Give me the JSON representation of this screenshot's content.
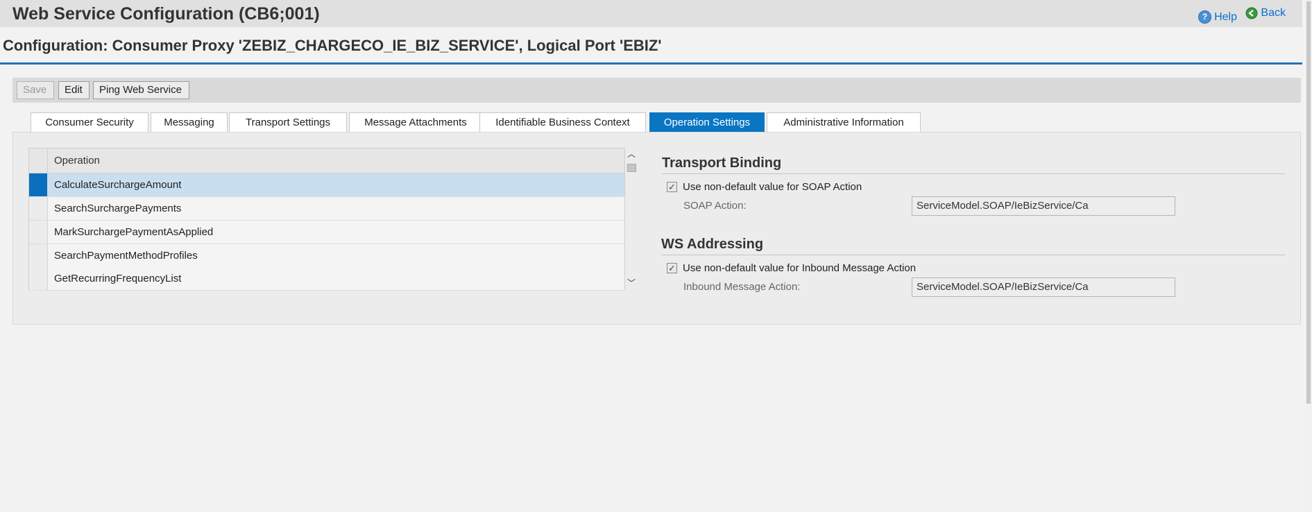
{
  "window": {
    "title": "Web Service Configuration (CB6;001)",
    "help_label": "Help",
    "back_label": "Back"
  },
  "subtitle": "Configuration: Consumer Proxy 'ZEBIZ_CHARGECO_IE_BIZ_SERVICE', Logical Port 'EBIZ'",
  "toolbar": {
    "save_label": "Save",
    "edit_label": "Edit",
    "ping_label": "Ping Web Service"
  },
  "tabs": [
    {
      "label": "Consumer Security"
    },
    {
      "label": "Messaging"
    },
    {
      "label": "Transport Settings"
    },
    {
      "label": "Message Attachments"
    },
    {
      "label": "Identifiable Business Context"
    },
    {
      "label": "Operation Settings",
      "active": true
    },
    {
      "label": "Administrative Information"
    }
  ],
  "operations_table": {
    "header": "Operation",
    "rows": [
      "CalculateSurchargeAmount",
      "SearchSurchargePayments",
      "MarkSurchargePaymentAsApplied",
      "SearchPaymentMethodProfiles",
      "GetRecurringFrequencyList"
    ],
    "selected_index": 0
  },
  "transport_binding": {
    "title": "Transport Binding",
    "checkbox_label": "Use non-default value for SOAP Action",
    "checked": true,
    "field_label": "SOAP Action:",
    "field_value": "ServiceModel.SOAP/IeBizService/Ca"
  },
  "ws_addressing": {
    "title": "WS Addressing",
    "checkbox_label": "Use non-default value for Inbound Message Action",
    "checked": true,
    "field_label": "Inbound Message Action:",
    "field_value": "ServiceModel.SOAP/IeBizService/Ca"
  },
  "colors": {
    "accent": "#0a75c2",
    "selected_row": "#c9dff0",
    "link": "#0a6ed1"
  }
}
